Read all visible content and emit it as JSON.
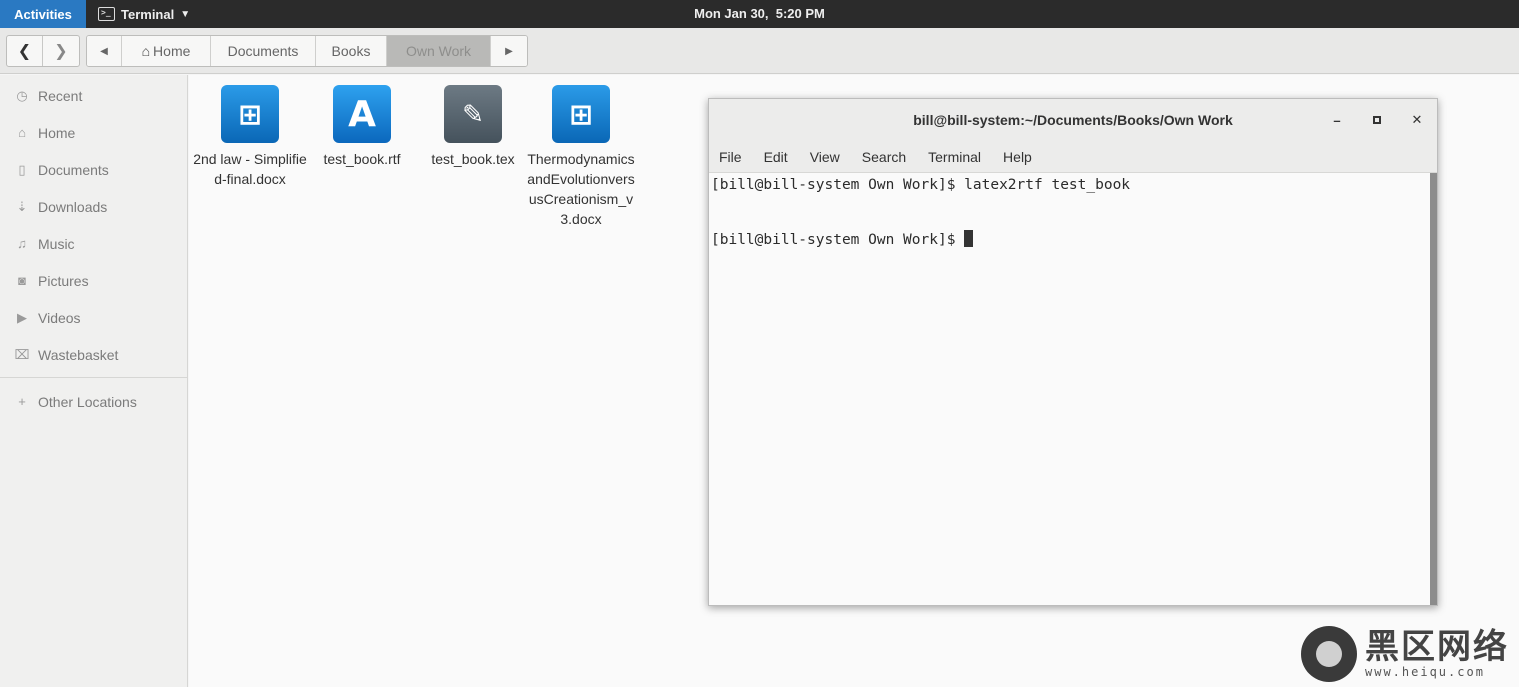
{
  "topbar": {
    "activities": "Activities",
    "app_name": "Terminal",
    "clock": "Mon Jan 30,  5:20 PM"
  },
  "pathbar": {
    "crumbs": [
      "Home",
      "Documents",
      "Books",
      "Own Work"
    ],
    "active": "Own Work"
  },
  "sidebar": {
    "items": [
      {
        "label": "Recent",
        "icon": "clock-icon"
      },
      {
        "label": "Home",
        "icon": "home-icon"
      },
      {
        "label": "Documents",
        "icon": "document-icon"
      },
      {
        "label": "Downloads",
        "icon": "download-icon"
      },
      {
        "label": "Music",
        "icon": "music-icon"
      },
      {
        "label": "Pictures",
        "icon": "camera-icon"
      },
      {
        "label": "Videos",
        "icon": "video-icon"
      },
      {
        "label": "Wastebasket",
        "icon": "trash-icon"
      }
    ],
    "other": "Other Locations"
  },
  "files": [
    {
      "name": "2nd law - Simplified-final.docx",
      "type": "docx"
    },
    {
      "name": "test_book.rtf",
      "type": "rtf"
    },
    {
      "name": "test_book.tex",
      "type": "tex"
    },
    {
      "name": "ThermodynamicsandEvolutionversusCreationism_v3.docx",
      "type": "docx"
    }
  ],
  "terminal": {
    "title": "bill@bill-system:~/Documents/Books/Own Work",
    "menu": [
      "File",
      "Edit",
      "View",
      "Search",
      "Terminal",
      "Help"
    ],
    "lines": [
      "[bill@bill-system Own Work]$ latex2rtf test_book",
      "",
      "[bill@bill-system Own Work]$ "
    ]
  },
  "watermark": {
    "cn": "黑区网络",
    "url": "www.heiqu.com"
  },
  "colors": {
    "activities_bg": "#2a79c2",
    "topbar_bg": "#2b2b2b",
    "docx_icon": "#1a82d4",
    "tex_icon": "#55626c"
  }
}
